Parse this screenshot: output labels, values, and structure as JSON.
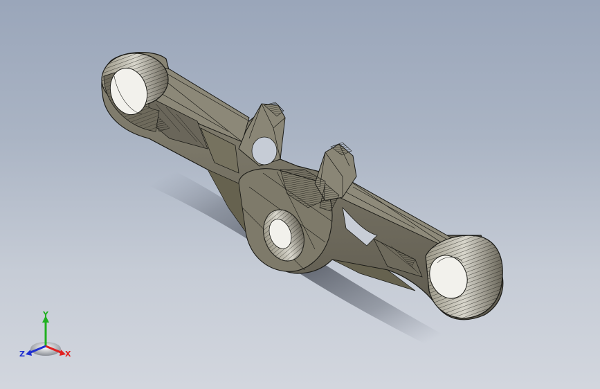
{
  "viewport": {
    "background_top": "#9aa6ba",
    "background_bottom": "#d2d6de"
  },
  "model": {
    "display_mode": "shaded-with-edges",
    "body_color": "#7a7666",
    "edge_color": "#1c1c18"
  },
  "triad": {
    "x_label": "X",
    "y_label": "Y",
    "z_label": "Z",
    "x_color": "#e02020",
    "y_color": "#20b020",
    "z_color": "#2030d0"
  }
}
